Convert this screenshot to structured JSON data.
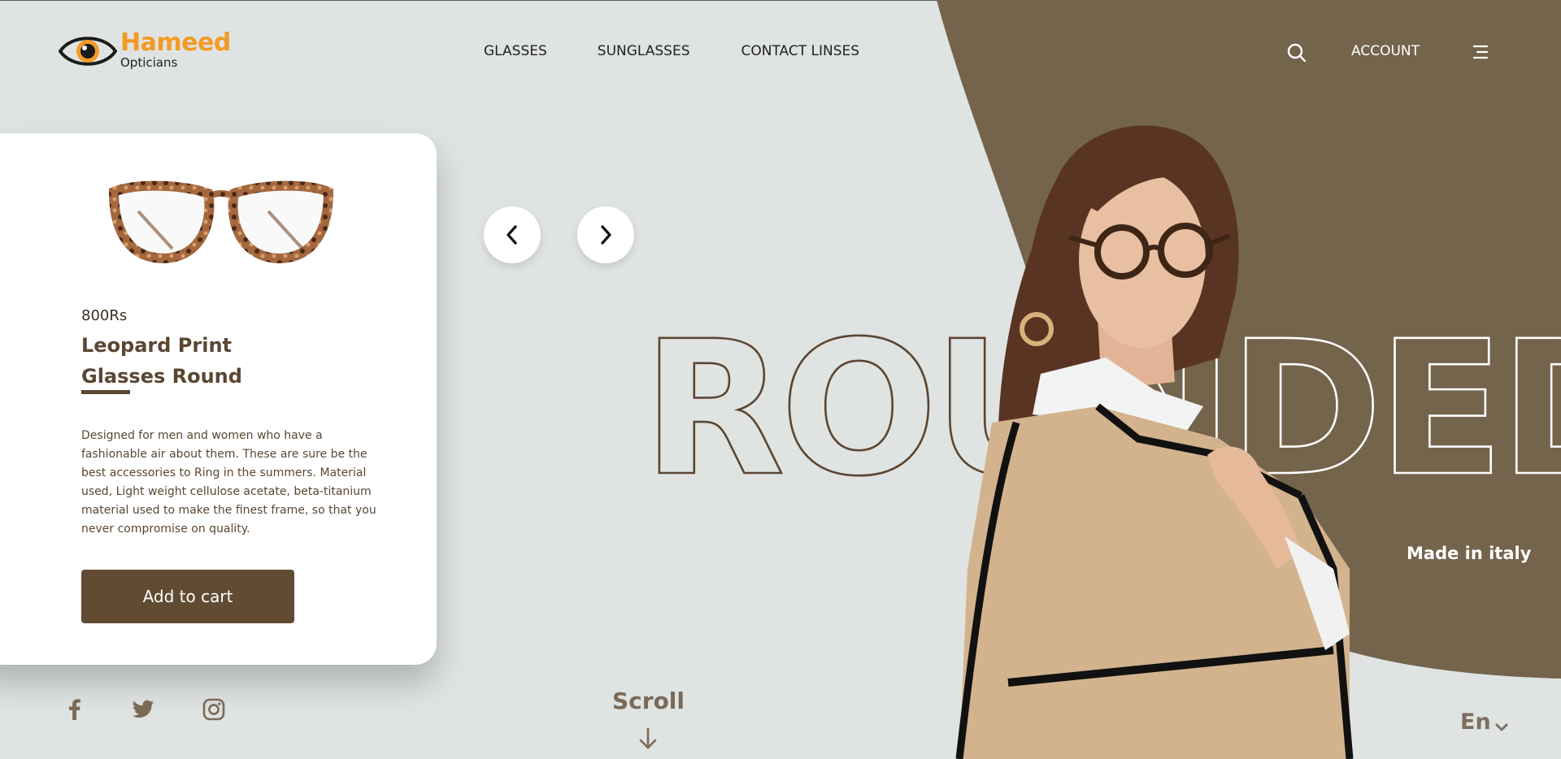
{
  "brand": {
    "name": "Hameed",
    "subtitle": "Opticians",
    "accent_color": "#f39a26"
  },
  "nav": {
    "items": [
      {
        "label": "GLASSES"
      },
      {
        "label": "SUNGLASSES"
      },
      {
        "label": "CONTACT LINSES"
      }
    ],
    "search_icon": "search-icon",
    "account_label": "ACCOUNT",
    "menu_icon": "menu-icon"
  },
  "product": {
    "price": "800Rs",
    "title": "Leopard Print Glasses Round",
    "description": "Designed for men and women who have a fashionable air about them. These are sure be the best accessories to Ring in the summers. Material used, Light weight cellulose acetate, beta-titanium material used to make the finest frame, so that you never compromise on quality.",
    "add_to_cart_label": "Add to cart",
    "button_color": "#614b32"
  },
  "carousel": {
    "prev_icon": "chevron-left-icon",
    "next_icon": "chevron-right-icon"
  },
  "hero": {
    "headline": "ROUNDED",
    "tagline": "Made in italy",
    "blob_color": "#74644c",
    "background_color": "#dfe3e2"
  },
  "footer": {
    "social": [
      "facebook-icon",
      "twitter-icon",
      "instagram-icon"
    ],
    "scroll_label": "Scroll",
    "language": "En"
  }
}
